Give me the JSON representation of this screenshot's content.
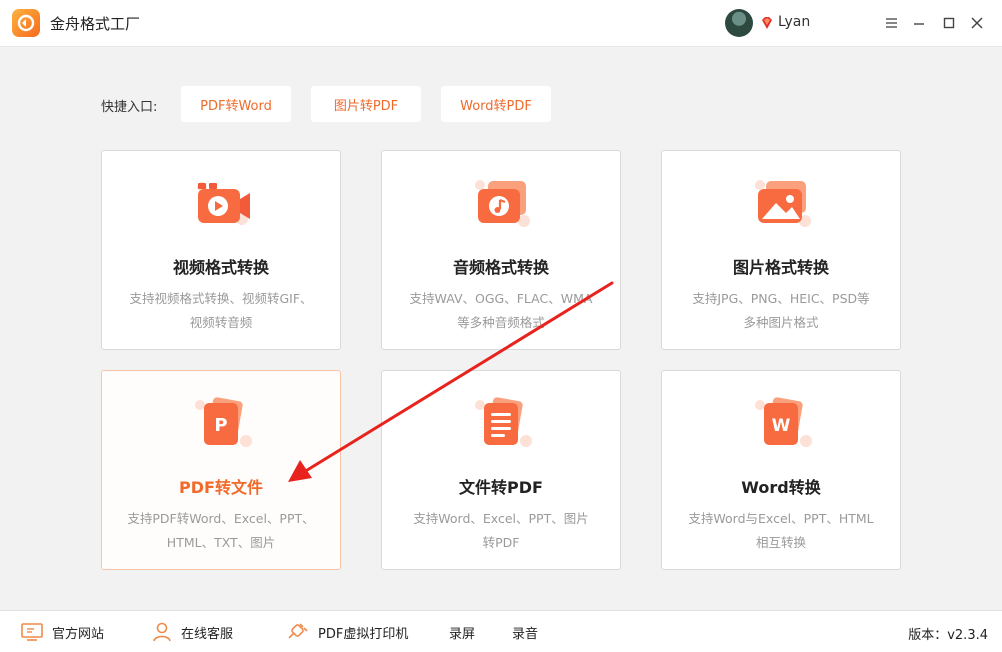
{
  "app": {
    "title": "金舟格式工厂"
  },
  "user": {
    "name": "Lyan"
  },
  "quick": {
    "label": "快捷入口:",
    "buttons": [
      "PDF转Word",
      "图片转PDF",
      "Word转PDF"
    ]
  },
  "cards": [
    {
      "title": "视频格式转换",
      "desc1": "支持视频格式转换、视频转GIF、",
      "desc2": "视频转音频",
      "icon": "video-icon"
    },
    {
      "title": "音频格式转换",
      "desc1": "支持WAV、OGG、FLAC、WMA",
      "desc2": "等多种音频格式",
      "icon": "music-icon"
    },
    {
      "title": "图片格式转换",
      "desc1": "支持JPG、PNG、HEIC、PSD等",
      "desc2": "多种图片格式",
      "icon": "image-icon"
    },
    {
      "title": "PDF转文件",
      "desc1": "支持PDF转Word、Excel、PPT、",
      "desc2": "HTML、TXT、图片",
      "icon": "pdf-p-icon"
    },
    {
      "title": "文件转PDF",
      "desc1": "支持Word、Excel、PPT、图片",
      "desc2": "转PDF",
      "icon": "document-icon"
    },
    {
      "title": "Word转换",
      "desc1": "支持Word与Excel、PPT、HTML",
      "desc2": "相互转换",
      "icon": "word-w-icon"
    }
  ],
  "cards_icon_letters": {
    "pdf": "P",
    "word": "W"
  },
  "bottom": {
    "website": "官方网站",
    "service": "在线客服",
    "printer": "PDF虚拟打印机",
    "screen_record": "录屏",
    "audio_record": "录音",
    "version": "版本：v2.3.4"
  },
  "colors": {
    "accent": "#f26a2a",
    "card_border_active": "#f9c3a8",
    "annotation_arrow": "#e8231d"
  }
}
